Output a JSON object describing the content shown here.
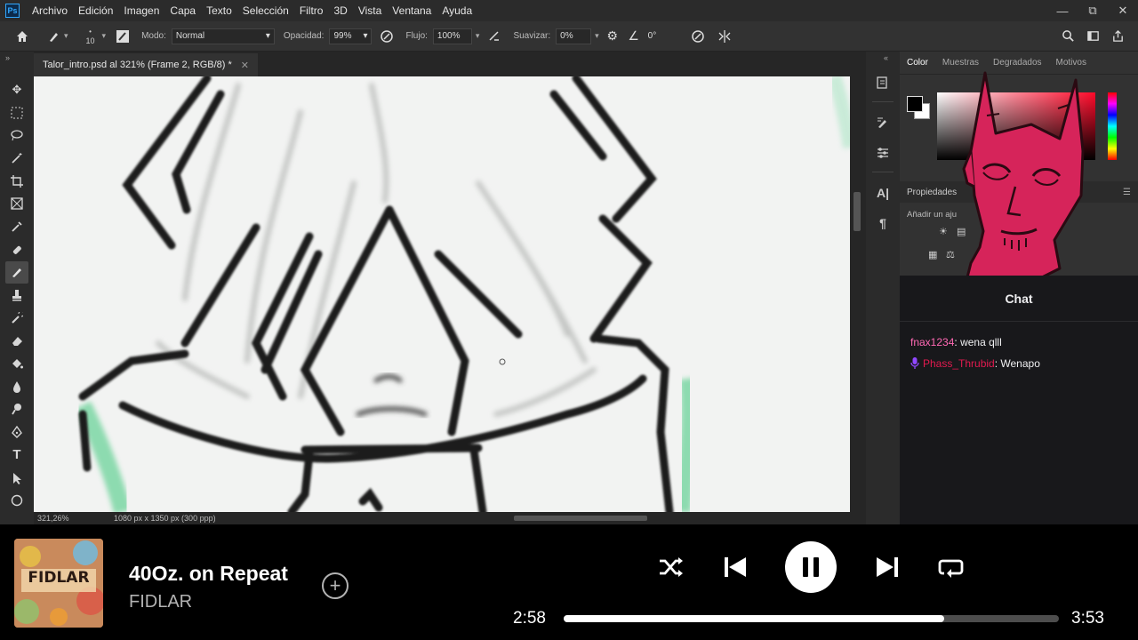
{
  "photoshop": {
    "logo": "Ps",
    "menu": [
      "Archivo",
      "Edición",
      "Imagen",
      "Capa",
      "Texto",
      "Selección",
      "Filtro",
      "3D",
      "Vista",
      "Ventana",
      "Ayuda"
    ],
    "options": {
      "brush_size": "10",
      "mode_label": "Modo:",
      "mode_value": "Normal",
      "opacity_label": "Opacidad:",
      "opacity_value": "99%",
      "flow_label": "Flujo:",
      "flow_value": "100%",
      "smoothing_label": "Suavizar:",
      "smoothing_value": "0%",
      "angle_value": "0°"
    },
    "document_tab": "Talor_intro.psd al 321% (Frame 2, RGB/8) *",
    "status": {
      "zoom": "321,26%",
      "doc_size": "1080 px x 1350 px (300 ppp)"
    },
    "panels": {
      "tabs": [
        "Color",
        "Muestras",
        "Degradados",
        "Motivos"
      ],
      "properties_title": "Propiedades",
      "adjust_label": "Añadir un aju"
    }
  },
  "chat": {
    "title": "Chat",
    "messages": [
      {
        "user": "fnax1234",
        "text": "wena qlll",
        "color": "#ff69b4",
        "mic": false
      },
      {
        "user": "Phass_Thrubid",
        "text": "Wenapo",
        "color": "#e21a4f",
        "mic": true
      }
    ]
  },
  "player": {
    "album_text": "FIDLAR",
    "title": "40Oz. on Repeat",
    "artist": "FIDLAR",
    "elapsed": "2:58",
    "total": "3:53",
    "progress": 0.768
  }
}
